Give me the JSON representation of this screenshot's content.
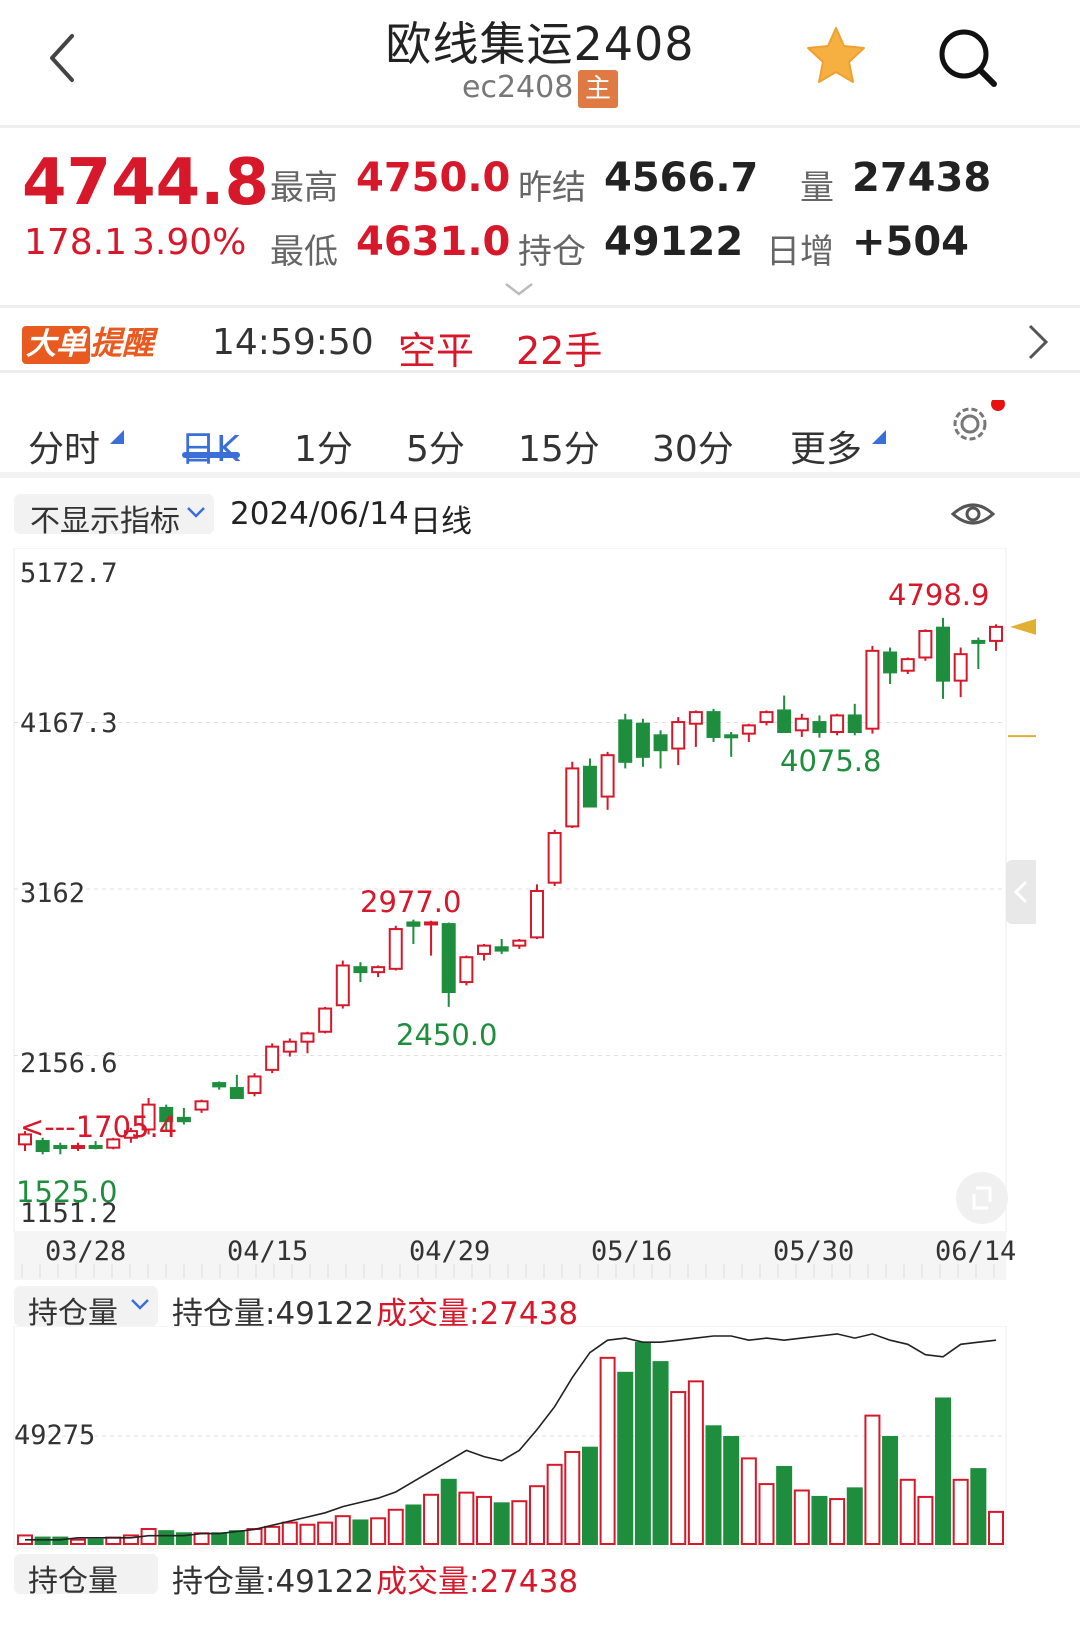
{
  "header": {
    "title": "欧线集运2408",
    "code": "ec2408",
    "main_badge": "主"
  },
  "quote": {
    "last": "4744.8",
    "change": "178.1",
    "change_pct": "3.90%",
    "high_label": "最高",
    "high": "4750.0",
    "low_label": "最低",
    "low": "4631.0",
    "prev_settle_label": "昨结",
    "prev_settle": "4566.7",
    "open_interest_label": "持仓",
    "open_interest": "49122",
    "volume_label": "量",
    "volume": "27438",
    "daily_inc_label": "日增",
    "daily_inc": "+504"
  },
  "alert": {
    "badge_a": "大单",
    "badge_b": "提醒",
    "time": "14:59:50",
    "type": "空平",
    "size": "22手"
  },
  "tabs": [
    {
      "label": "分时"
    },
    {
      "label": "日K"
    },
    {
      "label": "1分"
    },
    {
      "label": "5分"
    },
    {
      "label": "15分"
    },
    {
      "label": "30分"
    },
    {
      "label": "更多"
    }
  ],
  "chart_header": {
    "indicator_select": "不显示指标",
    "date": "2024/06/14",
    "period": "日线"
  },
  "sub_header": {
    "select": "持仓量",
    "oi_text": "持仓量:49122",
    "vol_text": "成交量:27438"
  },
  "sub_header_repeat": {
    "select": "持仓量",
    "oi_text": "持仓量:49122",
    "vol_text": "成交量:27438"
  },
  "chart_data": [
    {
      "type": "candlestick",
      "ylim": [
        1151.2,
        5172.7
      ],
      "ytick_labels": [
        "5172.7",
        "4167.3",
        "3162",
        "2156.6",
        "1151.2"
      ],
      "xtick_labels": [
        "03/28",
        "04/15",
        "04/29",
        "05/16",
        "05/30",
        "06/14"
      ],
      "annotations": [
        "4798.9",
        "4075.8",
        "2977.0",
        "2450.0",
        "1705.4",
        "1525.0"
      ],
      "candles": [
        {
          "o": 1620,
          "h": 1700,
          "l": 1580,
          "c": 1680
        },
        {
          "o": 1640,
          "h": 1660,
          "l": 1560,
          "c": 1580
        },
        {
          "o": 1610,
          "h": 1630,
          "l": 1560,
          "c": 1600
        },
        {
          "o": 1600,
          "h": 1630,
          "l": 1580,
          "c": 1610
        },
        {
          "o": 1610,
          "h": 1640,
          "l": 1590,
          "c": 1600
        },
        {
          "o": 1600,
          "h": 1660,
          "l": 1590,
          "c": 1650
        },
        {
          "o": 1660,
          "h": 1720,
          "l": 1630,
          "c": 1700
        },
        {
          "o": 1710,
          "h": 1900,
          "l": 1680,
          "c": 1860
        },
        {
          "o": 1840,
          "h": 1860,
          "l": 1700,
          "c": 1760
        },
        {
          "o": 1780,
          "h": 1840,
          "l": 1740,
          "c": 1760
        },
        {
          "o": 1830,
          "h": 1890,
          "l": 1810,
          "c": 1880
        },
        {
          "o": 1990,
          "h": 2000,
          "l": 1950,
          "c": 1970
        },
        {
          "o": 1960,
          "h": 2040,
          "l": 1910,
          "c": 1900
        },
        {
          "o": 1930,
          "h": 2050,
          "l": 1910,
          "c": 2030
        },
        {
          "o": 2070,
          "h": 2230,
          "l": 2050,
          "c": 2210
        },
        {
          "o": 2180,
          "h": 2260,
          "l": 2150,
          "c": 2240
        },
        {
          "o": 2240,
          "h": 2300,
          "l": 2170,
          "c": 2290
        },
        {
          "o": 2300,
          "h": 2450,
          "l": 2290,
          "c": 2440
        },
        {
          "o": 2460,
          "h": 2730,
          "l": 2440,
          "c": 2700
        },
        {
          "o": 2690,
          "h": 2720,
          "l": 2600,
          "c": 2660
        },
        {
          "o": 2660,
          "h": 2700,
          "l": 2630,
          "c": 2690
        },
        {
          "o": 2680,
          "h": 2940,
          "l": 2670,
          "c": 2920
        },
        {
          "o": 2960,
          "h": 2977,
          "l": 2830,
          "c": 2940
        },
        {
          "o": 2960,
          "h": 2970,
          "l": 2760,
          "c": 2960
        },
        {
          "o": 2950,
          "h": 2960,
          "l": 2450,
          "c": 2540
        },
        {
          "o": 2600,
          "h": 2760,
          "l": 2580,
          "c": 2750
        },
        {
          "o": 2770,
          "h": 2830,
          "l": 2730,
          "c": 2820
        },
        {
          "o": 2810,
          "h": 2860,
          "l": 2770,
          "c": 2790
        },
        {
          "o": 2820,
          "h": 2860,
          "l": 2800,
          "c": 2850
        },
        {
          "o": 2870,
          "h": 3190,
          "l": 2860,
          "c": 3150
        },
        {
          "o": 3200,
          "h": 3520,
          "l": 3180,
          "c": 3500
        },
        {
          "o": 3540,
          "h": 3930,
          "l": 3530,
          "c": 3890
        },
        {
          "o": 3900,
          "h": 3950,
          "l": 3740,
          "c": 3660
        },
        {
          "o": 3720,
          "h": 3990,
          "l": 3640,
          "c": 3970
        },
        {
          "o": 4180,
          "h": 4220,
          "l": 3890,
          "c": 3930
        },
        {
          "o": 4160,
          "h": 4190,
          "l": 3900,
          "c": 3960
        },
        {
          "o": 4090,
          "h": 4120,
          "l": 3890,
          "c": 4000
        },
        {
          "o": 4010,
          "h": 4200,
          "l": 3910,
          "c": 4170
        },
        {
          "o": 4160,
          "h": 4240,
          "l": 4020,
          "c": 4230
        },
        {
          "o": 4230,
          "h": 4250,
          "l": 4050,
          "c": 4080
        },
        {
          "o": 4090,
          "h": 4110,
          "l": 3960,
          "c": 4080
        },
        {
          "o": 4100,
          "h": 4160,
          "l": 4050,
          "c": 4150
        },
        {
          "o": 4170,
          "h": 4240,
          "l": 4150,
          "c": 4230
        },
        {
          "o": 4240,
          "h": 4330,
          "l": 4140,
          "c": 4110
        },
        {
          "o": 4120,
          "h": 4220,
          "l": 4080,
          "c": 4190
        },
        {
          "o": 4170,
          "h": 4210,
          "l": 4075.8,
          "c": 4110
        },
        {
          "o": 4110,
          "h": 4220,
          "l": 4090,
          "c": 4210
        },
        {
          "o": 4210,
          "h": 4280,
          "l": 4090,
          "c": 4110
        },
        {
          "o": 4130,
          "h": 4630,
          "l": 4100,
          "c": 4600
        },
        {
          "o": 4590,
          "h": 4620,
          "l": 4400,
          "c": 4470
        },
        {
          "o": 4480,
          "h": 4560,
          "l": 4460,
          "c": 4550
        },
        {
          "o": 4560,
          "h": 4730,
          "l": 4540,
          "c": 4720
        },
        {
          "o": 4740,
          "h": 4798.9,
          "l": 4310,
          "c": 4420
        },
        {
          "o": 4420,
          "h": 4620,
          "l": 4320,
          "c": 4580
        },
        {
          "o": 4660,
          "h": 4680,
          "l": 4490,
          "c": 4650
        },
        {
          "o": 4660,
          "h": 4760,
          "l": 4600,
          "c": 4744.8
        }
      ]
    },
    {
      "type": "bar",
      "title": "持仓量 / 成交量",
      "ytick_labels": [
        "49275"
      ],
      "volume": [
        4,
        3,
        3,
        2,
        2,
        3,
        4,
        7,
        6,
        5,
        5,
        5,
        6,
        7,
        8,
        10,
        9,
        10,
        13,
        11,
        12,
        16,
        18,
        23,
        30,
        24,
        22,
        19,
        20,
        27,
        37,
        43,
        45,
        87,
        80,
        94,
        85,
        71,
        76,
        55,
        50,
        40,
        28,
        36,
        25,
        22,
        21,
        26,
        60,
        50,
        30,
        22,
        68,
        30,
        35,
        15
      ],
      "open_interest": [
        2,
        2,
        2,
        3,
        3,
        3,
        3,
        4,
        4,
        4,
        5,
        5,
        6,
        7,
        9,
        11,
        13,
        15,
        18,
        20,
        22,
        25,
        30,
        35,
        40,
        45,
        42,
        40,
        45,
        55,
        66,
        80,
        92,
        98,
        99,
        97,
        97,
        98,
        99,
        100,
        100,
        98,
        99,
        98,
        99,
        100,
        101,
        99,
        101,
        98,
        96,
        91,
        90,
        96,
        97,
        98
      ]
    }
  ]
}
